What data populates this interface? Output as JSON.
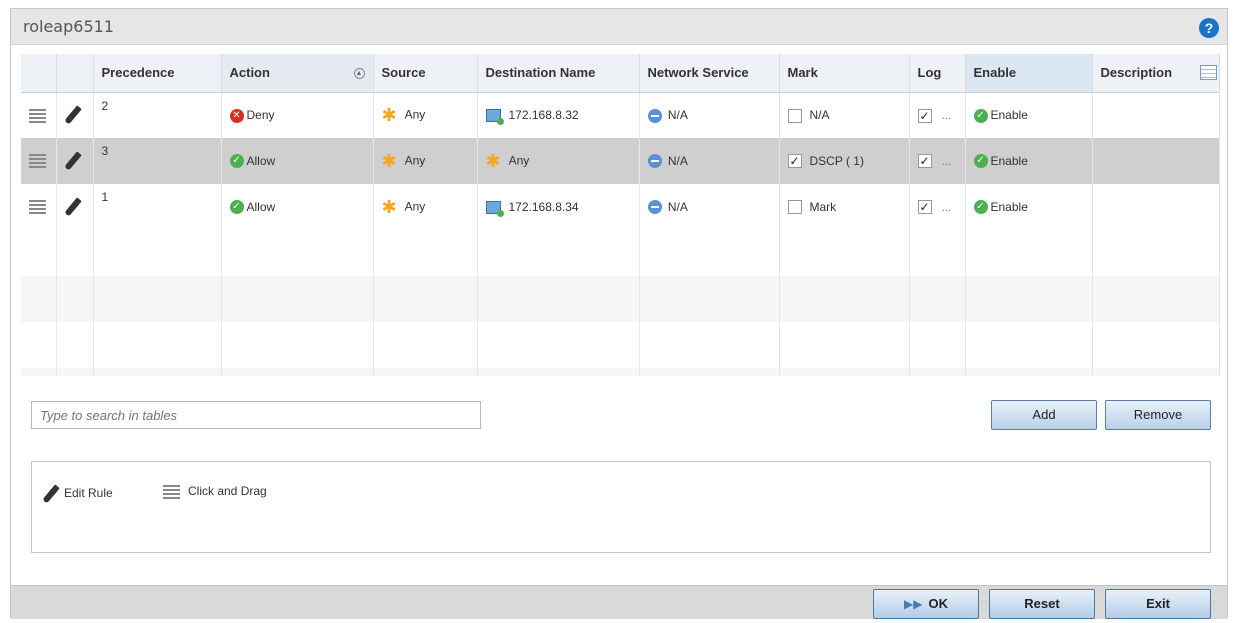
{
  "window": {
    "title": "roleap6511",
    "help_icon": "?"
  },
  "table": {
    "headers": [
      "Precedence",
      "Action",
      "Source",
      "Destination Name",
      "Network Service",
      "Mark",
      "Log",
      "Enable",
      "Description"
    ],
    "rows": [
      {
        "precedence": "2",
        "action": "Deny",
        "action_status": "deny",
        "source": "Any",
        "destination": "172.168.8.32",
        "destination_type": "host",
        "network_service": "N/A",
        "mark": "N/A",
        "mark_checked": false,
        "log": "...",
        "log_checked": true,
        "enable": "Enable",
        "description": ""
      },
      {
        "precedence": "3",
        "action": "Allow",
        "action_status": "allow",
        "source": "Any",
        "destination": "Any",
        "destination_type": "any",
        "network_service": "N/A",
        "mark": "DSCP ( 1)",
        "mark_checked": true,
        "log": "...",
        "log_checked": true,
        "enable": "Enable",
        "description": ""
      },
      {
        "precedence": "1",
        "action": "Allow",
        "action_status": "allow",
        "source": "Any",
        "destination": "172.168.8.34",
        "destination_type": "host",
        "network_service": "N/A",
        "mark": "Mark",
        "mark_checked": false,
        "log": "...",
        "log_checked": true,
        "enable": "Enable",
        "description": ""
      }
    ]
  },
  "search": {
    "placeholder": "Type to search in tables"
  },
  "buttons": {
    "add": "Add",
    "remove": "Remove",
    "ok": "OK",
    "reset": "Reset",
    "exit": "Exit"
  },
  "legend": {
    "edit_rule": "Edit Rule",
    "click_and_drag": "Click and Drag"
  },
  "icons": {
    "deny": "red-x-circle-icon",
    "allow": "green-check-circle-icon",
    "any": "orange-star-icon",
    "host": "host-icon",
    "network_service": "blue-minus-circle-icon"
  }
}
